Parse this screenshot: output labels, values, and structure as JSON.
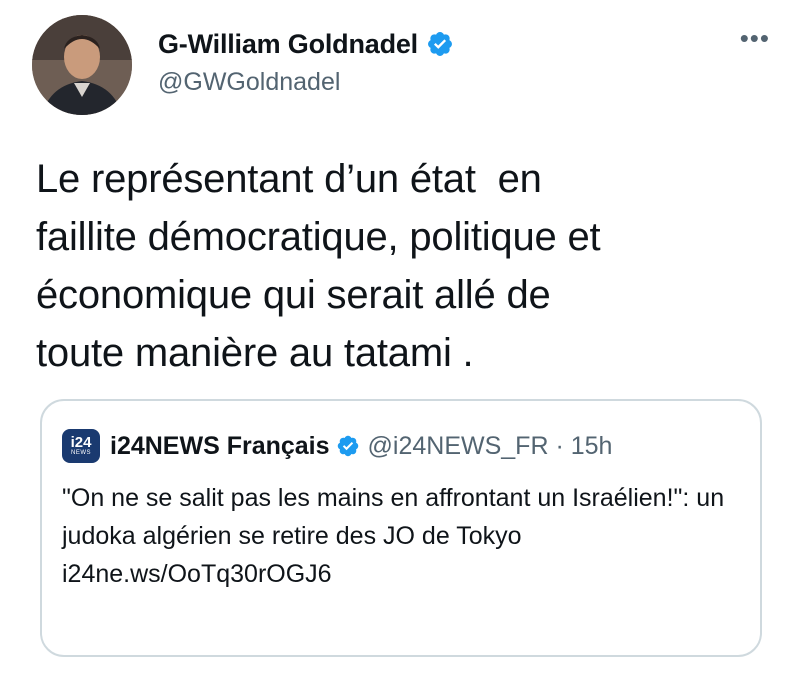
{
  "author": {
    "name": "G-William Goldnadel",
    "handle": "@GWGoldnadel",
    "verified_icon": "verified-badge",
    "avatar_icon": "profile-photo"
  },
  "more_label": "•••",
  "tweet": {
    "text": "Le représentant d’un état  en\nfaillite démocratique, politique et\néconomique qui serait allé de\ntoute manière au tatami ."
  },
  "quoted": {
    "logo_text": "i24",
    "logo_sub": "NEWS",
    "name": "i24NEWS Français",
    "handle_time": "@i24NEWS_FR · 15h",
    "text": "\"On ne se salit pas les mains en affrontant un Israélien!\": un judoka algérien se retire des JO de Tokyo",
    "link": "i24ne.ws/OoTq30rOGJ6"
  },
  "colors": {
    "verified": "#1d9bf0",
    "secondary_text": "#536471",
    "border": "#cfd9de"
  }
}
